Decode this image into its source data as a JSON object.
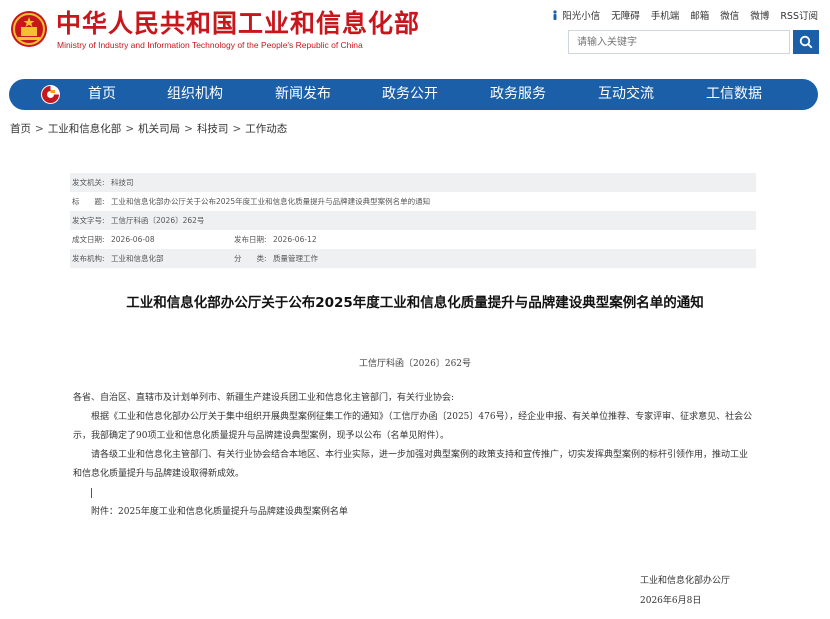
{
  "header": {
    "title_cn": "中华人民共和国工业和信息化部",
    "title_en": "Ministry of Industry and Information Technology of the People's Republic of China",
    "top_links": [
      "阳光小信",
      "无障碍",
      "手机端",
      "邮箱",
      "微信",
      "微博",
      "RSS订阅"
    ],
    "search_placeholder": "请输入关键字"
  },
  "nav": {
    "items": [
      "首页",
      "组织机构",
      "新闻发布",
      "政务公开",
      "政务服务",
      "互动交流",
      "工信数据"
    ]
  },
  "breadcrumb": [
    "首页",
    "工业和信息化部",
    "机关司局",
    "科技司",
    "工作动态"
  ],
  "meta": {
    "issuer_label": "发文机关:",
    "issuer": "科技司",
    "title_label": "标　　题:",
    "title": "工业和信息化部办公厅关于公布2025年度工业和信息化质量提升与品牌建设典型案例名单的通知",
    "docno_label": "发文字号:",
    "docno": "工信厅科函〔2026〕262号",
    "created_label": "成文日期:",
    "created": "2026-06-08",
    "published_label": "发布日期:",
    "published": "2026-06-12",
    "org_label": "发布机构:",
    "org": "工业和信息化部",
    "category_label": "分　　类:",
    "category": "质量管理工作"
  },
  "article": {
    "title": "工业和信息化部办公厅关于公布2025年度工业和信息化质量提升与品牌建设典型案例名单的通知",
    "docno": "工信厅科函〔2026〕262号",
    "salutation": "各省、自治区、直辖市及计划单列市、新疆生产建设兵团工业和信息化主管部门，有关行业协会:",
    "p1": "根据《工业和信息化部办公厅关于集中组织开展典型案例征集工作的通知》（工信厅办函〔2025〕476号），经企业申报、有关单位推荐、专家评审、征求意见、社会公示，我部确定了90项工业和信息化质量提升与品牌建设典型案例，现予以公布（名单见附件）。",
    "p2": "请各级工业和信息化主管部门、有关行业协会结合本地区、本行业实际，进一步加强对典型案例的政策支持和宣传推广，切实发挥典型案例的标杆引领作用，推动工业和信息化质量提升与品牌建设取得新成效。",
    "attachment": "附件：2025年度工业和信息化质量提升与品牌建设典型案例名单",
    "sign_org": "工业和信息化部办公厅",
    "sign_date": "2026年6月8日"
  },
  "colors": {
    "brand_red": "#c8161d",
    "nav_blue": "#1a5fa8"
  }
}
